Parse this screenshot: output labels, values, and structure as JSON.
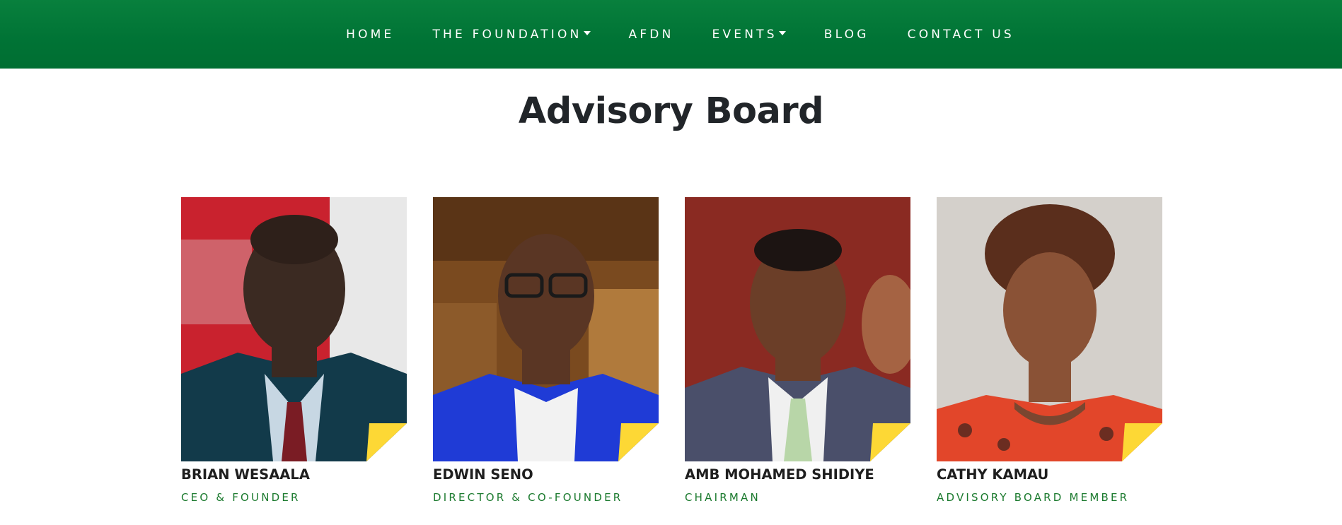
{
  "nav": {
    "items": [
      {
        "label": "HOME",
        "dropdown": false
      },
      {
        "label": "THE FOUNDATION",
        "dropdown": true
      },
      {
        "label": "AFDN",
        "dropdown": false
      },
      {
        "label": "EVENTS",
        "dropdown": true
      },
      {
        "label": "BLOG",
        "dropdown": false
      },
      {
        "label": "CONTACT US",
        "dropdown": false
      }
    ]
  },
  "page": {
    "title": "Advisory Board"
  },
  "colors": {
    "nav_green": "#007335",
    "accent_yellow": "#fdd835",
    "role_green": "#1b7a2e"
  },
  "members": [
    {
      "name": "BRIAN WESAALA",
      "role": "CEO & FOUNDER"
    },
    {
      "name": "EDWIN SENO",
      "role": "DIRECTOR & CO-FOUNDER"
    },
    {
      "name": "AMB MOHAMED SHIDIYE",
      "role": "CHAIRMAN"
    },
    {
      "name": "CATHY KAMAU",
      "role": "ADVISORY BOARD MEMBER"
    }
  ]
}
